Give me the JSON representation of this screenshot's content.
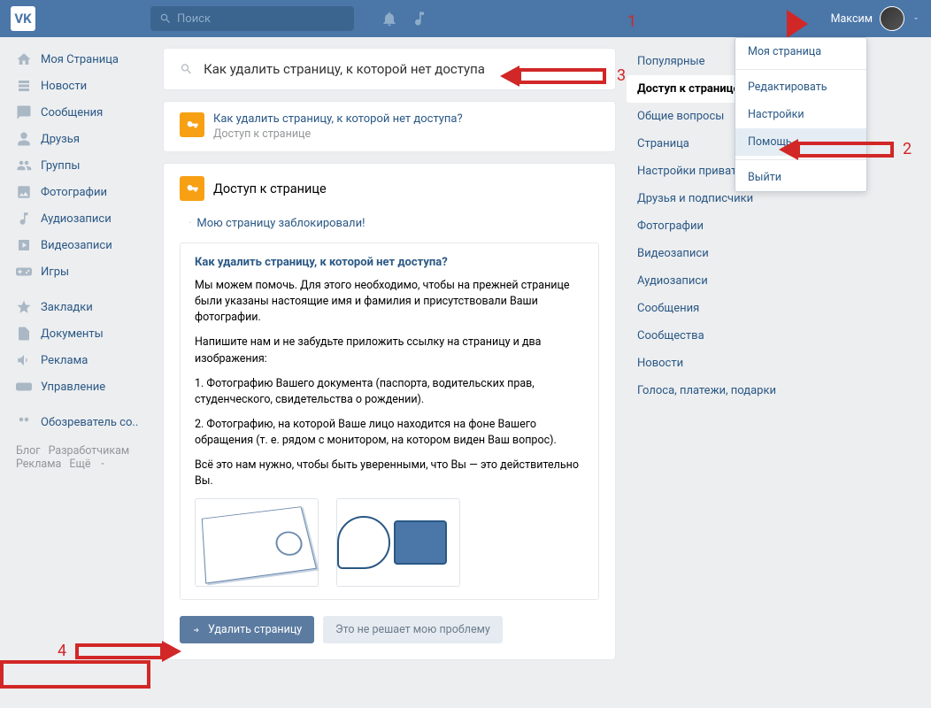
{
  "topbar": {
    "search_placeholder": "Поиск",
    "user_name": "Максим"
  },
  "sidebar": {
    "items": [
      {
        "label": "Моя Страница"
      },
      {
        "label": "Новости"
      },
      {
        "label": "Сообщения"
      },
      {
        "label": "Друзья"
      },
      {
        "label": "Группы"
      },
      {
        "label": "Фотографии"
      },
      {
        "label": "Аудиозаписи"
      },
      {
        "label": "Видеозаписи"
      },
      {
        "label": "Игры"
      }
    ],
    "items2": [
      {
        "label": "Закладки"
      },
      {
        "label": "Документы"
      },
      {
        "label": "Реклама"
      },
      {
        "label": "Управление"
      }
    ],
    "items3": [
      {
        "label": "Обозреватель со.."
      }
    ]
  },
  "footer": {
    "blog": "Блог",
    "devs": "Разработчикам",
    "ads": "Реклама",
    "more": "Ещё"
  },
  "search_card": {
    "value": "Как удалить страницу, к которой нет доступа"
  },
  "result": {
    "title": "Как удалить страницу, к которой нет доступа?",
    "subtitle": "Доступ к странице"
  },
  "content": {
    "section_title": "Доступ к странице",
    "blocked_link": "Мою страницу заблокировали!"
  },
  "article": {
    "title": "Как удалить страницу, к которой нет доступа?",
    "p1": "Мы можем помочь. Для этого необходимо, чтобы на прежней странице были указаны настоящие имя и фамилия и присутствовали Ваши фотографии.",
    "p2": "Напишите нам и не забудьте приложить ссылку на страницу и два изображения:",
    "p3": "1. Фотографию Вашего документа (паспорта, водительских прав, студенческого, свидетельства о рождении).",
    "p4": "2. Фотографию, на которой Ваше лицо находится на фоне Вашего обращения (т. е. рядом с монитором, на котором виден Ваш вопрос).",
    "p5": "Всё это нам нужно, чтобы быть уверенными, что Вы — это действительно Вы."
  },
  "actions": {
    "primary": "Удалить страницу",
    "secondary": "Это не решает мою проблему"
  },
  "categories": [
    "Популярные",
    "Доступ к странице",
    "Общие вопросы",
    "Страница",
    "Настройки приватности",
    "Друзья и подписчики",
    "Фотографии",
    "Видеозаписи",
    "Аудиозаписи",
    "Сообщения",
    "Сообщества",
    "Новости",
    "Голоса, платежи, подарки"
  ],
  "profile_menu": [
    "Моя страница",
    "Редактировать",
    "Настройки",
    "Помощь",
    "Выйти"
  ],
  "annotations": {
    "n1": "1",
    "n2": "2",
    "n3": "3",
    "n4": "4"
  }
}
